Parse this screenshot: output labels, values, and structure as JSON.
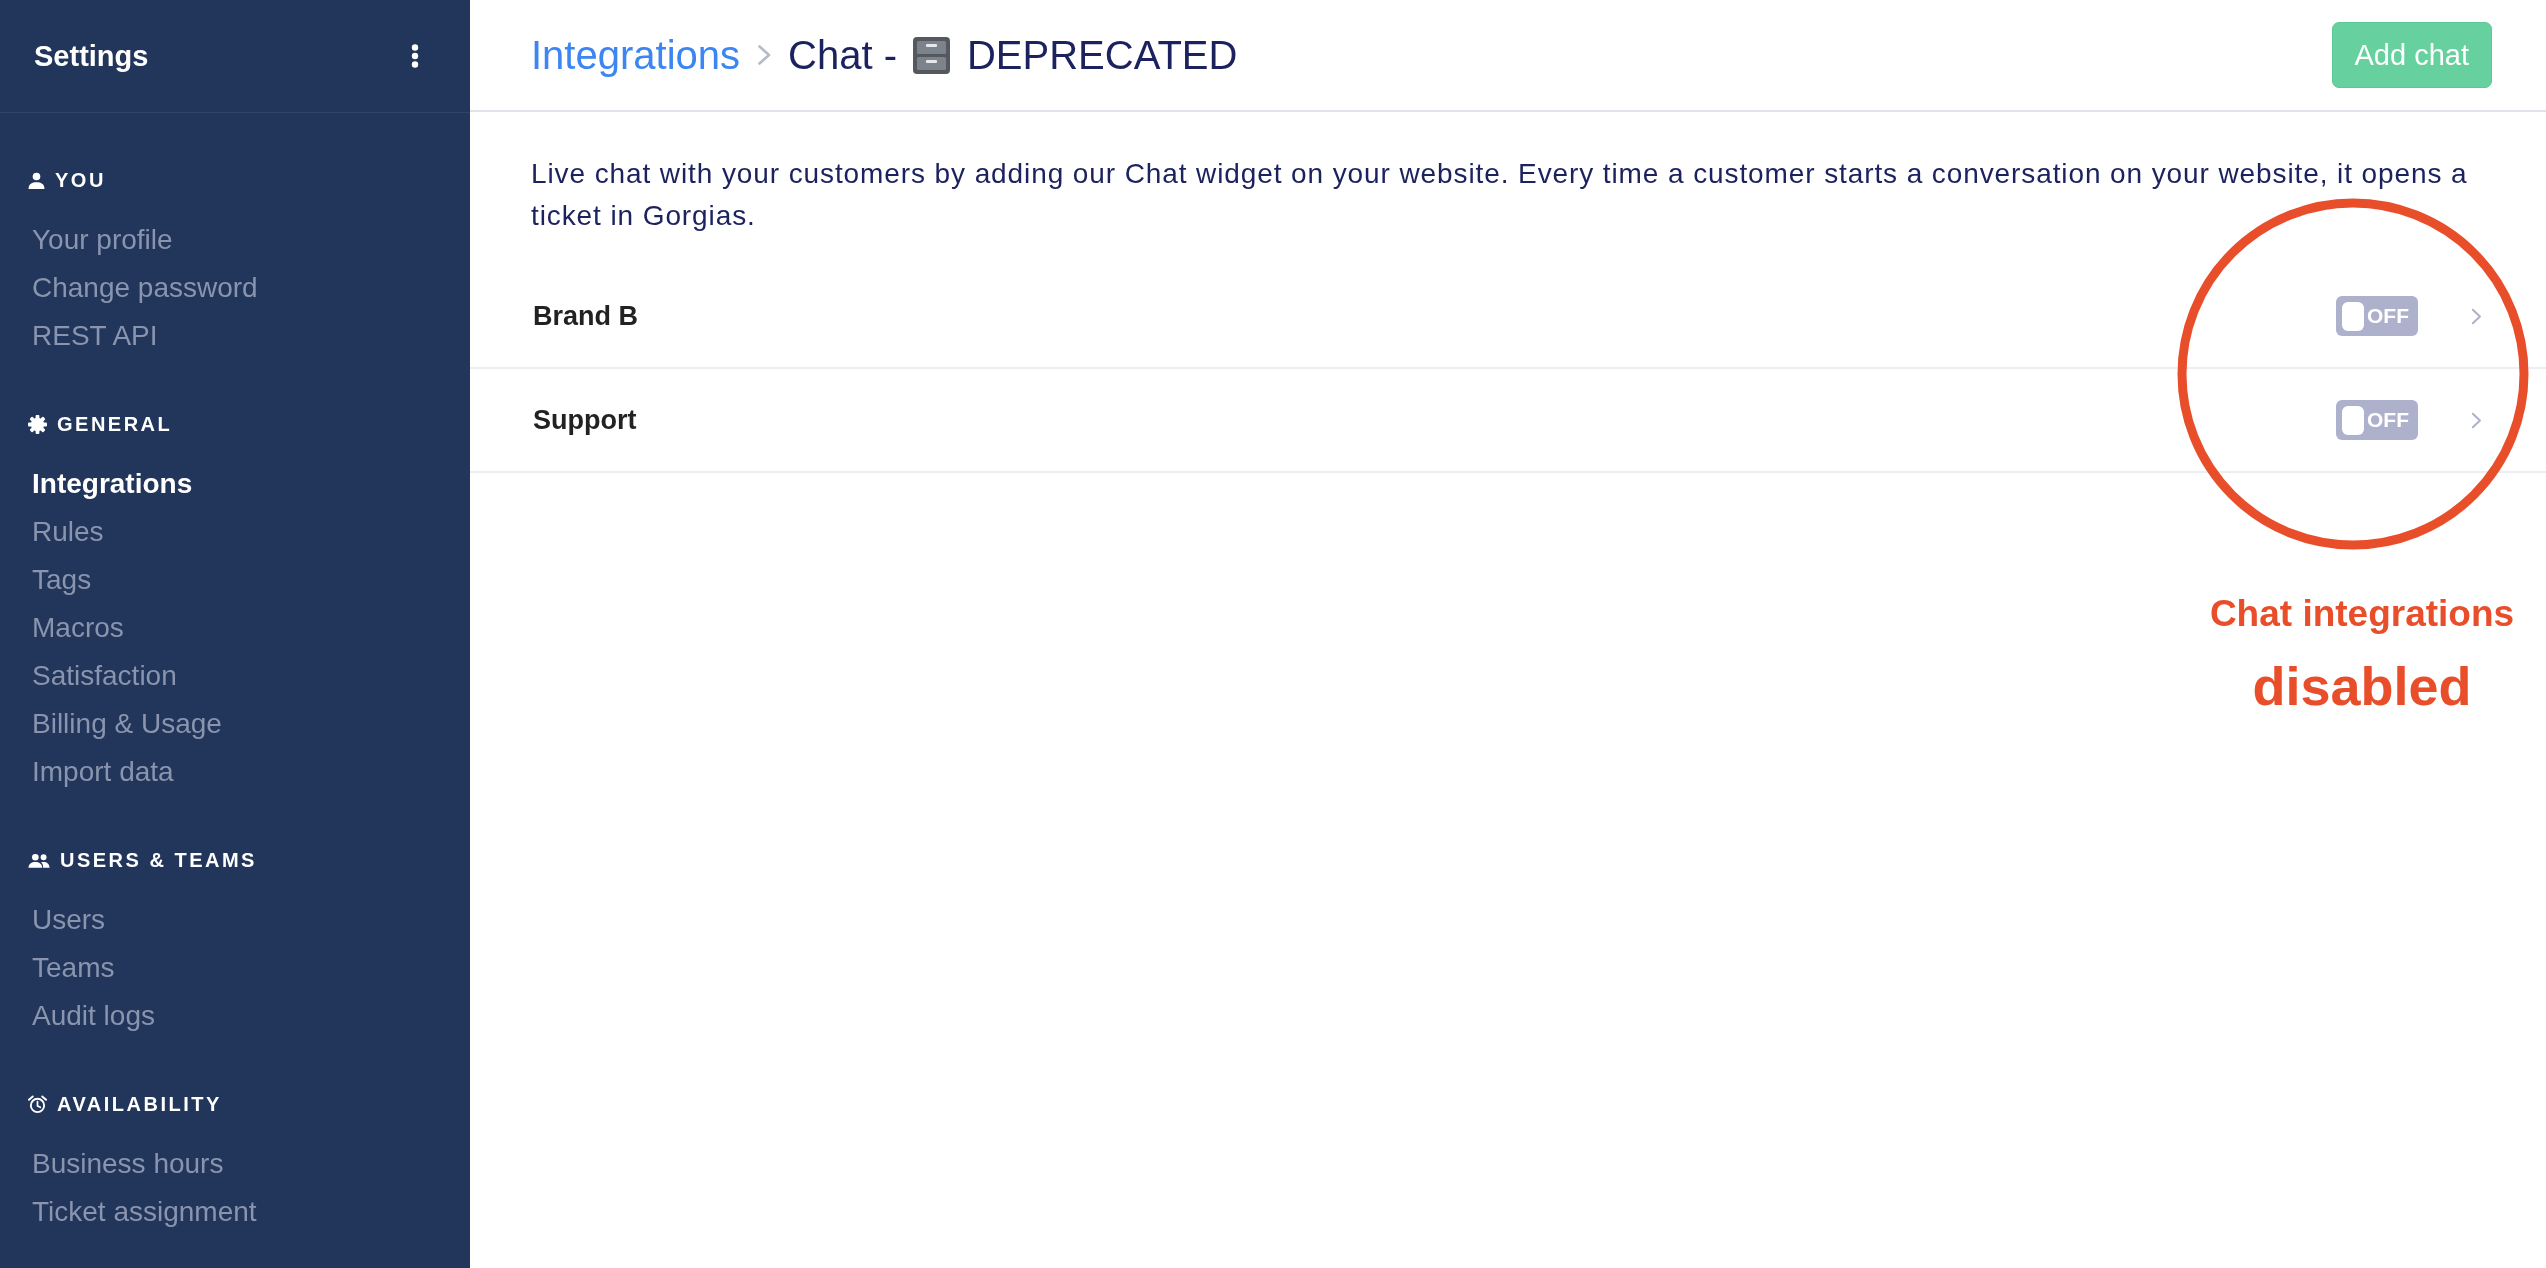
{
  "sidebar": {
    "title": "Settings",
    "sections": [
      {
        "heading": "YOU",
        "items": [
          {
            "label": "Your profile",
            "selected": false
          },
          {
            "label": "Change password",
            "selected": false
          },
          {
            "label": "REST API",
            "selected": false
          }
        ]
      },
      {
        "heading": "GENERAL",
        "items": [
          {
            "label": "Integrations",
            "selected": true
          },
          {
            "label": "Rules",
            "selected": false
          },
          {
            "label": "Tags",
            "selected": false
          },
          {
            "label": "Macros",
            "selected": false
          },
          {
            "label": "Satisfaction",
            "selected": false
          },
          {
            "label": "Billing & Usage",
            "selected": false
          },
          {
            "label": "Import data",
            "selected": false
          }
        ]
      },
      {
        "heading": "USERS & TEAMS",
        "items": [
          {
            "label": "Users",
            "selected": false
          },
          {
            "label": "Teams",
            "selected": false
          },
          {
            "label": "Audit logs",
            "selected": false
          }
        ]
      },
      {
        "heading": "AVAILABILITY",
        "items": [
          {
            "label": "Business hours",
            "selected": false
          },
          {
            "label": "Ticket assignment",
            "selected": false
          }
        ]
      }
    ]
  },
  "header": {
    "breadcrumb_link": "Integrations",
    "title": "Chat -",
    "title_suffix": "DEPRECATED",
    "button": "Add chat"
  },
  "description": "Live chat with your customers by adding our Chat widget on your website. Every time a customer starts a conversation on your website, it opens a ticket in Gorgias.",
  "integrations": [
    {
      "name": "Brand B",
      "on": false,
      "toggle_label": "OFF"
    },
    {
      "name": "Support",
      "on": false,
      "toggle_label": "OFF"
    }
  ],
  "annotation": {
    "text": "Chat integrations",
    "emphasis": "disabled"
  }
}
